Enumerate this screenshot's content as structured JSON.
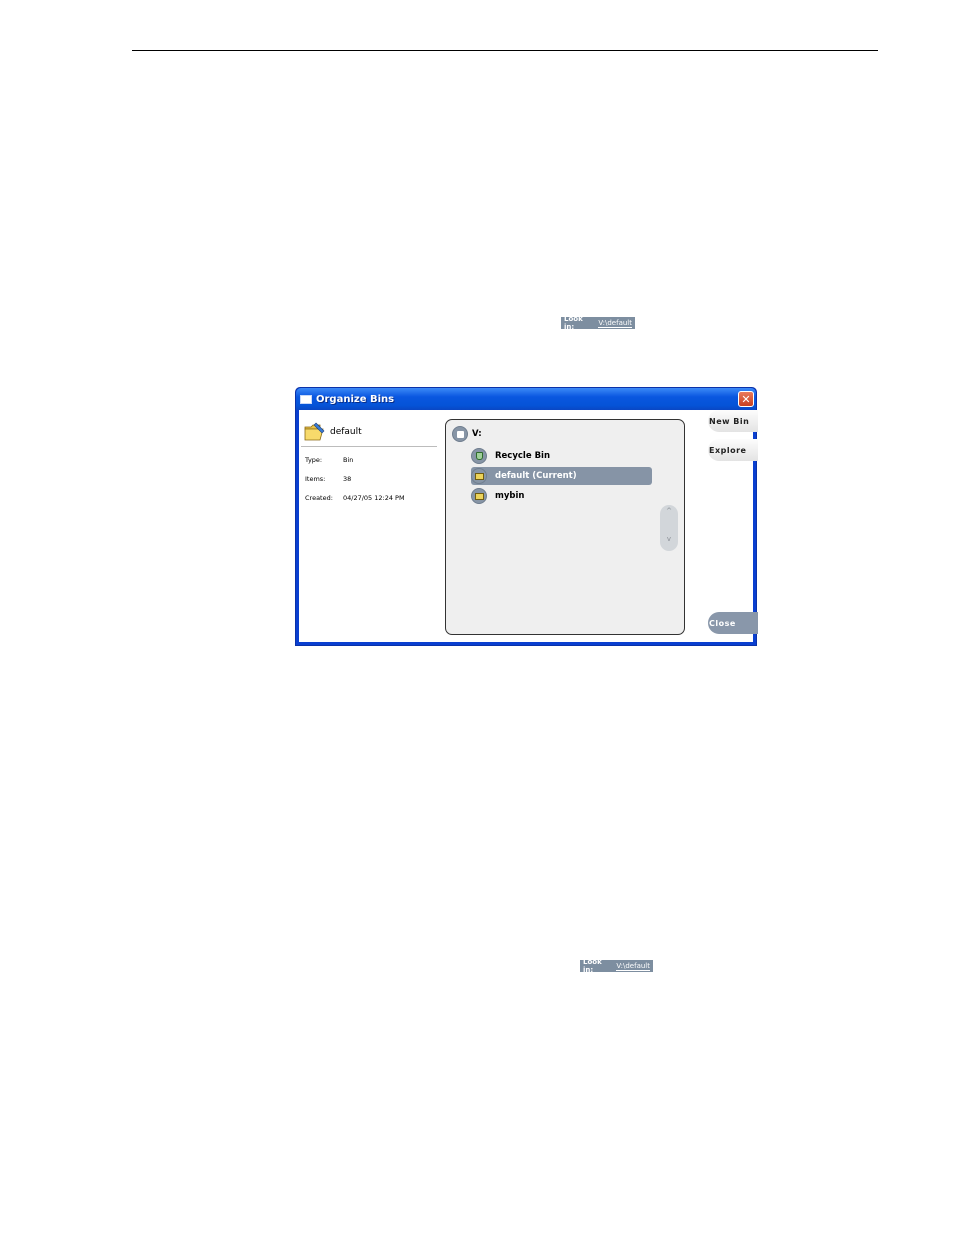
{
  "lookin_snippet_1": {
    "label": "Look in:",
    "value": "V:\\default"
  },
  "lookin_snippet_2": {
    "label": "Look in:",
    "value": "V:\\default"
  },
  "dialog": {
    "title": "Organize Bins",
    "close_glyph": "✕",
    "info": {
      "name": "default",
      "rows": [
        {
          "key": "Type:",
          "value": "Bin"
        },
        {
          "key": "Items:",
          "value": "38"
        },
        {
          "key": "Created:",
          "value": "04/27/05 12:24 PM"
        }
      ]
    },
    "tree": {
      "root": "V:",
      "items": [
        {
          "label": "Recycle Bin",
          "icon": "recycle-bin-icon"
        },
        {
          "label": "default (Current)",
          "icon": "bin-icon",
          "selected": true
        },
        {
          "label": "mybin",
          "icon": "bin-icon"
        }
      ],
      "scroll_up": "^",
      "scroll_down": "v"
    },
    "buttons": {
      "new_bin": "New Bin",
      "explore": "Explore",
      "close": "Close"
    }
  },
  "colors": {
    "title_bar": "#0553d7",
    "selected_row": "#8694a6",
    "button_dark": "#8997aa"
  }
}
